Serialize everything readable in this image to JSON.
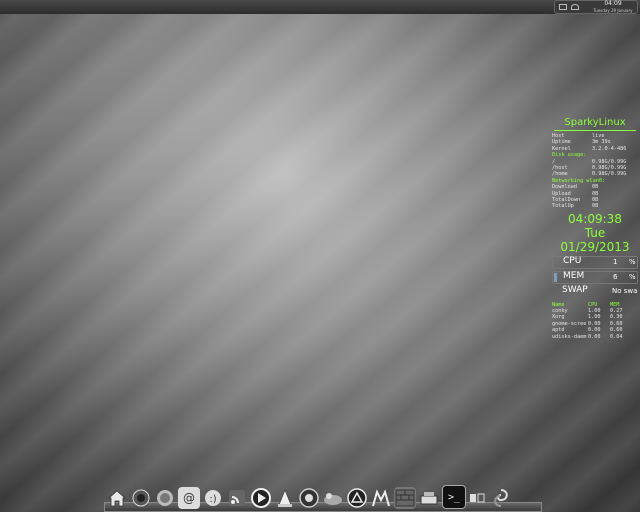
{
  "panel": {
    "clock": "04:09",
    "date": "Tuesday 29 January"
  },
  "conky": {
    "title": "SparkyLinux",
    "info": [
      {
        "k": "Host",
        "v": "live"
      },
      {
        "k": "Uptime",
        "v": "3m 39s"
      },
      {
        "k": "Kernel",
        "v": "3.2.0-4-486"
      }
    ],
    "disk_header": "Disk usage:",
    "disks": [
      {
        "k": "/",
        "v": "0.98G/0.99G"
      },
      {
        "k": "/host",
        "v": "0.98G/0.99G"
      },
      {
        "k": "/home",
        "v": "0.98G/0.99G"
      }
    ],
    "net_header": "Networking wlan0:",
    "net": [
      {
        "k": "Download",
        "v": "0B"
      },
      {
        "k": "Upload",
        "v": "0B"
      },
      {
        "k": "TotalDown",
        "v": "0B"
      },
      {
        "k": "TotalUp",
        "v": "0B"
      }
    ],
    "time": "04:09:38",
    "day": "Tue",
    "date": "01/29/2013",
    "cpu": {
      "label": "CPU",
      "value": "1",
      "unit": "%"
    },
    "mem": {
      "label": "MEM",
      "value": "6",
      "unit": "%"
    },
    "swap": {
      "label": "SWAP",
      "value": "No swap"
    },
    "proc_headers": [
      "Name",
      "CPU",
      "MEM"
    ],
    "procs": [
      [
        "conky",
        "1.00",
        "0.27"
      ],
      [
        "Xorg",
        "1.00",
        "0.30"
      ],
      [
        "gnome-scree",
        "0.00",
        "0.60"
      ],
      [
        "aptd",
        "0.00",
        "0.60"
      ],
      [
        "udisks-daem",
        "0.00",
        "0.04"
      ]
    ]
  },
  "dock": {
    "icons": [
      "home-icon",
      "browser-icon",
      "mail-icon",
      "email-at-icon",
      "chat-icon",
      "rss-icon",
      "media-player-icon",
      "vlc-icon",
      "firefox-icon",
      "gimp-icon",
      "inkscape-icon",
      "terminal-bars-icon",
      "brick-wall-icon",
      "system-icon",
      "terminal-icon",
      "settings-icon",
      "swirl-icon"
    ]
  }
}
